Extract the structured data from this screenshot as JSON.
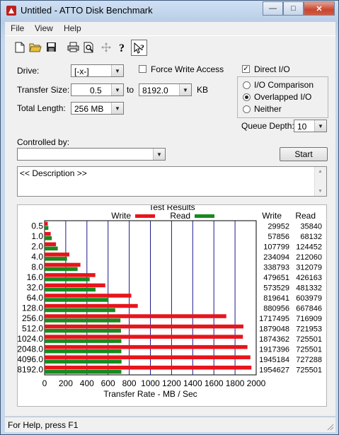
{
  "window": {
    "title": "Untitled - ATTO Disk Benchmark",
    "min": "—",
    "max": "□",
    "close": "✕"
  },
  "menu": [
    "File",
    "View",
    "Help"
  ],
  "toolbar_icons": [
    "new-file-icon",
    "open-folder-icon",
    "save-icon",
    "print-icon",
    "print-preview-icon",
    "move-icon",
    "help-icon",
    "context-help-icon"
  ],
  "settings": {
    "drive_label": "Drive:",
    "drive_value": "[-x-]",
    "transfer_size_label": "Transfer Size:",
    "transfer_from": "0.5",
    "to_label": "to",
    "transfer_to": "8192.0",
    "kb_label": "KB",
    "total_length_label": "Total Length:",
    "total_length_value": "256 MB",
    "force_write_label": "Force Write Access",
    "force_write_checked": false,
    "direct_io_label": "Direct I/O",
    "direct_io_checked": true,
    "io_comparison_label": "I/O Comparison",
    "overlapped_label": "Overlapped I/O",
    "neither_label": "Neither",
    "selected_mode": "overlapped",
    "queue_depth_label": "Queue Depth:",
    "queue_depth_value": "10",
    "controlled_by_label": "Controlled by:",
    "controlled_by_value": "",
    "start_label": "Start",
    "description": "<< Description >>"
  },
  "chart_data": {
    "type": "bar",
    "title": "Test Results",
    "legend": [
      "Write",
      "Read"
    ],
    "colors": {
      "write": "#e8141b",
      "read": "#178a1e"
    },
    "xlabel": "Transfer Rate - MB / Sec",
    "xlim": [
      0,
      2000
    ],
    "xticks": [
      "0",
      "200",
      "400",
      "600",
      "800",
      "1000",
      "1200",
      "1400",
      "1600",
      "1800",
      "2000"
    ],
    "categories": [
      "0.5",
      "1.0",
      "2.0",
      "4.0",
      "8.0",
      "16.0",
      "32.0",
      "64.0",
      "128.0",
      "256.0",
      "512.0",
      "1024.0",
      "2048.0",
      "4096.0",
      "8192.0"
    ],
    "series": [
      {
        "name": "Write",
        "values": [
          29.952,
          57.856,
          107.799,
          234.094,
          338.793,
          479.651,
          573.529,
          819.641,
          880.956,
          1717.495,
          1879.048,
          1874.362,
          1917.396,
          1945.184,
          1954.627
        ]
      },
      {
        "name": "Read",
        "values": [
          35.84,
          68.132,
          124.452,
          212.06,
          312.079,
          426.163,
          481.332,
          603.979,
          667.846,
          716.909,
          721.953,
          725.501,
          725.501,
          727.288,
          725.501
        ]
      }
    ],
    "table_headers": [
      "Write",
      "Read"
    ],
    "write_kb": [
      "29952",
      "57856",
      "107799",
      "234094",
      "338793",
      "479651",
      "573529",
      "819641",
      "880956",
      "1717495",
      "1879048",
      "1874362",
      "1917396",
      "1945184",
      "1954627"
    ],
    "read_kb": [
      "35840",
      "68132",
      "124452",
      "212060",
      "312079",
      "426163",
      "481332",
      "603979",
      "667846",
      "716909",
      "721953",
      "725501",
      "725501",
      "727288",
      "725501"
    ]
  },
  "status": {
    "text": "For Help, press F1"
  }
}
